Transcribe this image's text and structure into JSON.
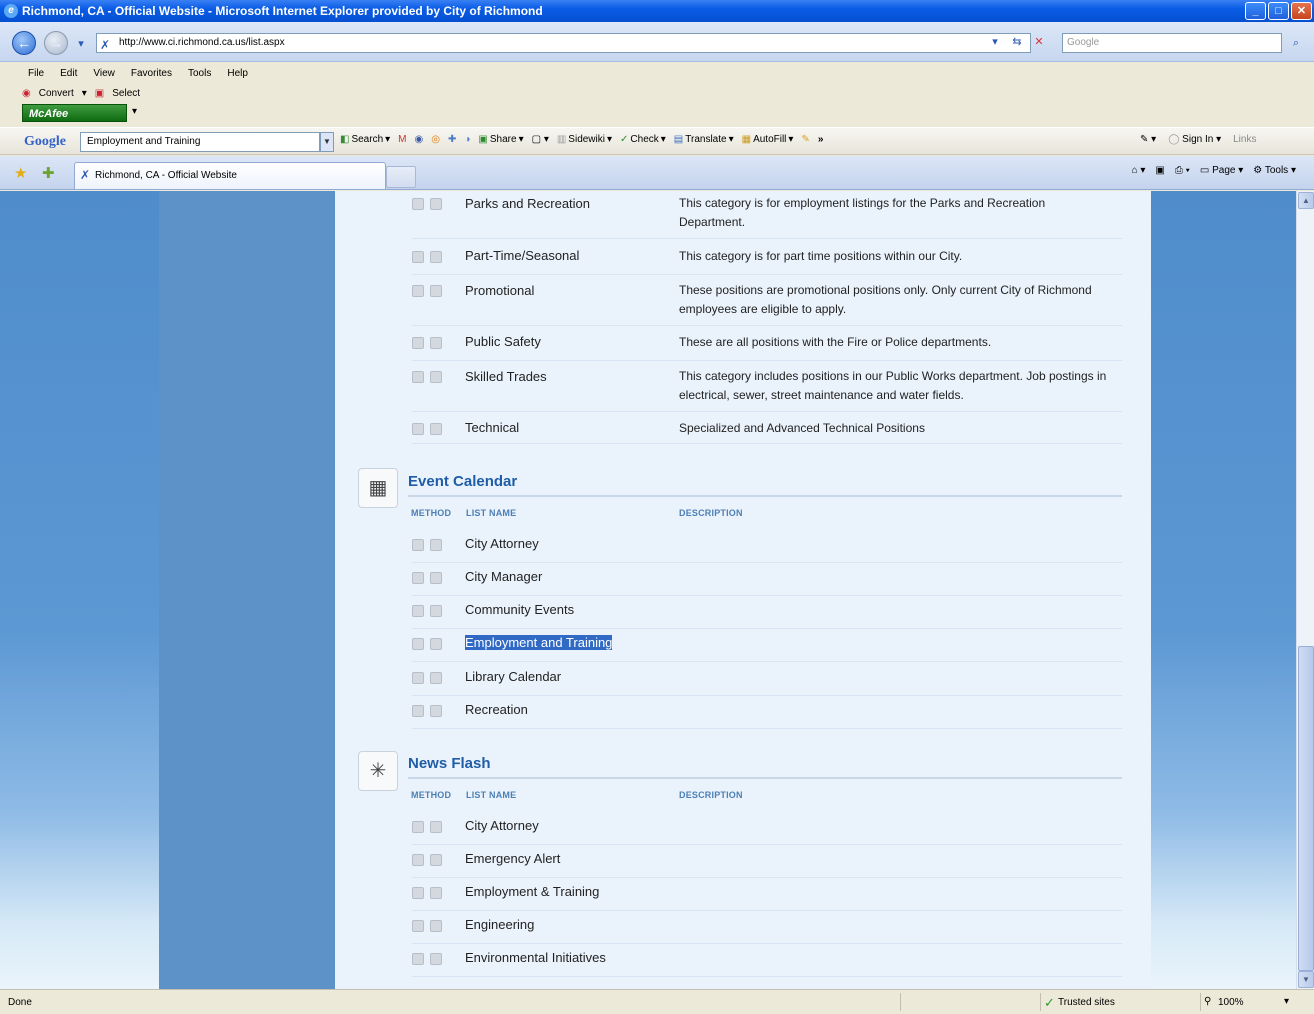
{
  "window": {
    "title": "Richmond, CA - Official Website - Microsoft Internet Explorer provided by City of Richmond",
    "buttons": {
      "minimize": "_",
      "maximize": "□",
      "close": "✕"
    }
  },
  "address_bar": {
    "url": "http://www.ci.richmond.ca.us/list.aspx",
    "search_placeholder": "Google"
  },
  "menu": [
    "File",
    "Edit",
    "View",
    "Favorites",
    "Tools",
    "Help"
  ],
  "addons": {
    "convert": "Convert",
    "select": "Select",
    "mcafee": "McAfee"
  },
  "google_toolbar": {
    "logo": "Google",
    "query": "Employment and Training",
    "items": [
      "Search",
      "Share",
      "Sidewiki",
      "Check",
      "Translate",
      "AutoFill"
    ],
    "more": "»",
    "sign_in": "Sign In",
    "links": "Links"
  },
  "tab": {
    "title": "Richmond, CA - Official Website"
  },
  "command_bar": {
    "page": "Page",
    "tools": "Tools"
  },
  "job_rows": [
    {
      "name": "Parks and Recreation",
      "desc": "This category is for employment listings for the Parks and Recreation Department."
    },
    {
      "name": "Part-Time/Seasonal",
      "desc": "This category is for part time positions within our City."
    },
    {
      "name": "Promotional",
      "desc": "These positions are promotional positions only. Only current City of Richmond employees are eligible to apply."
    },
    {
      "name": "Public Safety",
      "desc": "These are all positions with the Fire or Police departments."
    },
    {
      "name": "Skilled Trades",
      "desc": "This category includes positions in our Public Works department. Job postings in electrical, sewer, street maintenance and water fields."
    },
    {
      "name": "Technical",
      "desc": "Specialized and Advanced Technical Positions"
    }
  ],
  "event_calendar": {
    "title": "Event Calendar",
    "headers": {
      "method": "METHOD",
      "list_name": "LIST NAME",
      "description": "DESCRIPTION"
    },
    "rows": [
      "City Attorney",
      "City Manager",
      "Community Events",
      "Employment and Training",
      "Library Calendar",
      "Recreation"
    ]
  },
  "news_flash": {
    "title": "News Flash",
    "headers": {
      "method": "METHOD",
      "list_name": "LIST NAME",
      "description": "DESCRIPTION"
    },
    "rows": [
      "City Attorney",
      "Emergency Alert",
      "Employment & Training",
      "Engineering",
      "Environmental Initiatives"
    ]
  },
  "status": {
    "text": "Done",
    "zone": "Trusted sites",
    "zoom": "100%"
  }
}
